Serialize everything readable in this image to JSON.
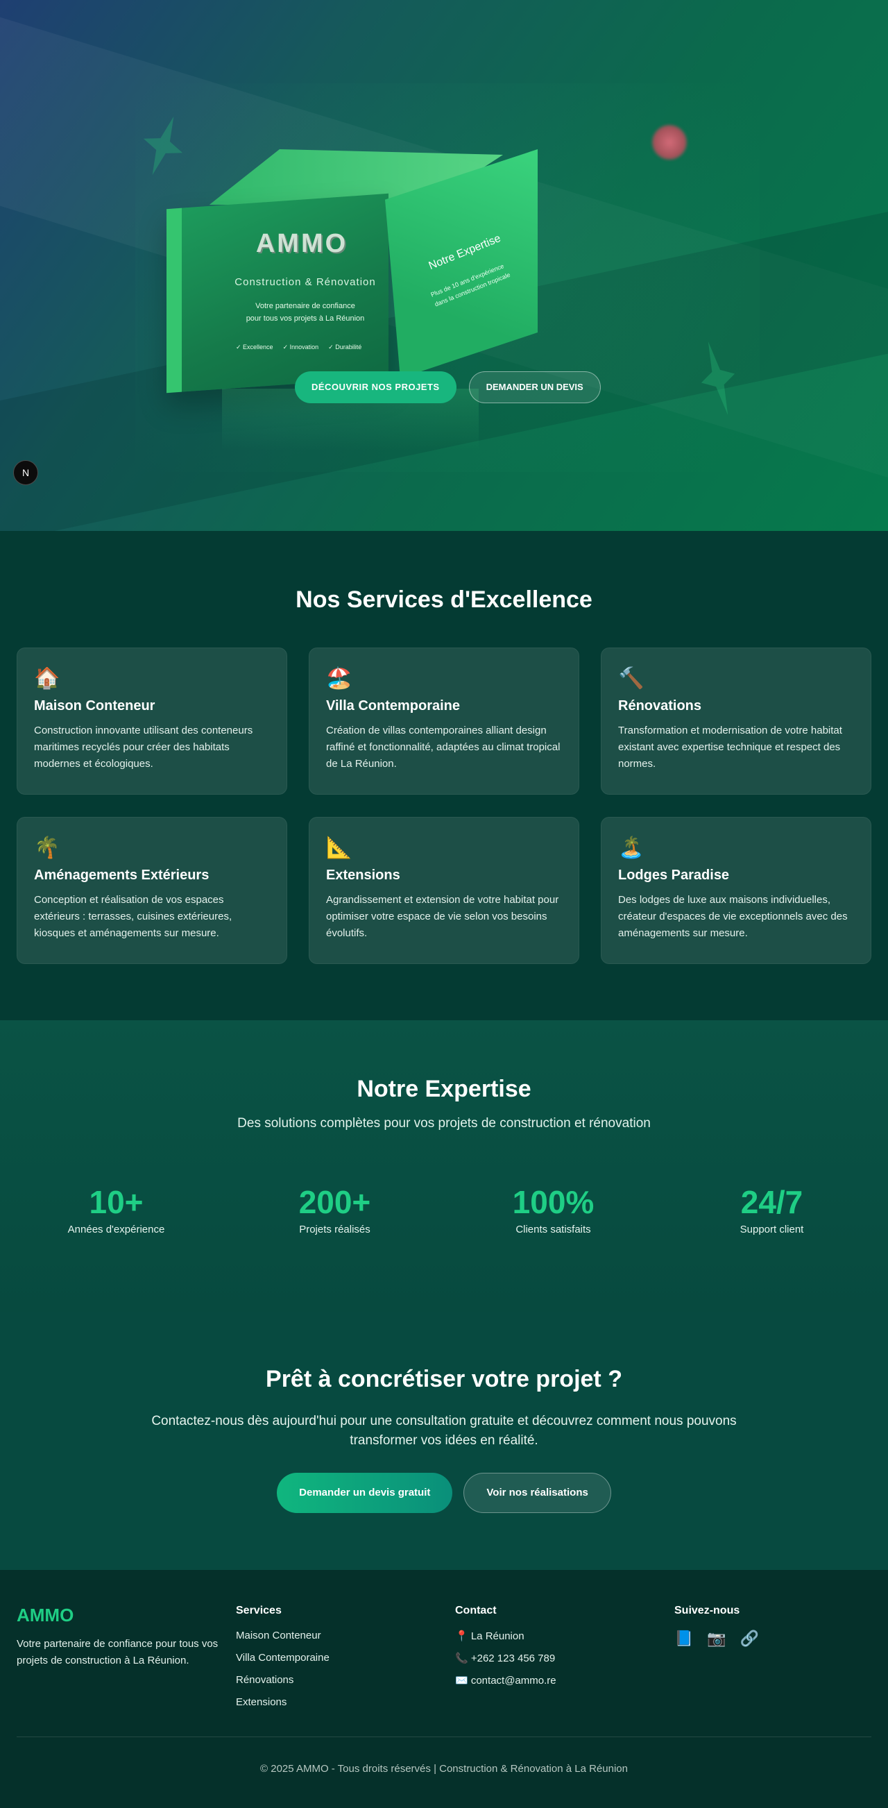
{
  "hero": {
    "brand": "AMMO",
    "brand_subtitle": "Construction & Rénovation",
    "tagline_line1": "Votre partenaire de confiance",
    "tagline_line2": "pour tous vos projets à La Réunion",
    "checks": [
      "✓ Excellence",
      "✓ Innovation",
      "✓ Durabilité"
    ],
    "panel_title": "Notre Expertise",
    "panel_sub_line1": "Plus de 10 ans d'expérience",
    "panel_sub_line2": "dans la construction tropicale",
    "cta_primary": "DÉCOUVRIR NOS PROJETS",
    "cta_secondary": "DEMANDER UN DEVIS",
    "scroll_icon": "N"
  },
  "services": {
    "title": "Nos Services d'Excellence",
    "items": [
      {
        "icon": "🏠",
        "icon_name": "house-icon",
        "title": "Maison Conteneur",
        "text": "Construction innovante utilisant des conteneurs maritimes recyclés pour créer des habitats modernes et écologiques."
      },
      {
        "icon": "🏖️",
        "icon_name": "beach-villa-icon",
        "title": "Villa Contemporaine",
        "text": "Création de villas contemporaines alliant design raffiné et fonctionnalité, adaptées au climat tropical de La Réunion."
      },
      {
        "icon": "🔨",
        "icon_name": "hammer-icon",
        "title": "Rénovations",
        "text": "Transformation et modernisation de votre habitat existant avec expertise technique et respect des normes."
      },
      {
        "icon": "🌴",
        "icon_name": "palm-tree-icon",
        "title": "Aménagements Extérieurs",
        "text": "Conception et réalisation de vos espaces extérieurs : terrasses, cuisines extérieures, kiosques et aménagements sur mesure."
      },
      {
        "icon": "📐",
        "icon_name": "set-square-icon",
        "title": "Extensions",
        "text": "Agrandissement et extension de votre habitat pour optimiser votre espace de vie selon vos besoins évolutifs."
      },
      {
        "icon": "🏝️",
        "icon_name": "island-icon",
        "title": "Lodges Paradise",
        "text": "Des lodges de luxe aux maisons individuelles, créateur d'espaces de vie exceptionnels avec des aménagements sur mesure."
      }
    ]
  },
  "expertise": {
    "title": "Notre Expertise",
    "subtitle": "Des solutions complètes pour vos projets de construction et rénovation",
    "stats": [
      {
        "value": "10+",
        "label": "Années d'expérience"
      },
      {
        "value": "200+",
        "label": "Projets réalisés"
      },
      {
        "value": "100%",
        "label": "Clients satisfaits"
      },
      {
        "value": "24/7",
        "label": "Support client"
      }
    ]
  },
  "cta": {
    "title": "Prêt à concrétiser votre projet ?",
    "description": "Contactez-nous dès aujourd'hui pour une consultation gratuite et découvrez comment nous pouvons transformer vos idées en réalité.",
    "primary": "Demander un devis gratuit",
    "secondary": "Voir nos réalisations"
  },
  "footer": {
    "logo": "AMMO",
    "about": "Votre partenaire de confiance pour tous vos projets de construction à La Réunion.",
    "services_title": "Services",
    "services": [
      "Maison Conteneur",
      "Villa Contemporaine",
      "Rénovations",
      "Extensions"
    ],
    "contact_title": "Contact",
    "contact": [
      "📍 La Réunion",
      "📞 +262 123 456 789",
      "✉️ contact@ammo.re"
    ],
    "social_title": "Suivez-nous",
    "social": [
      {
        "icon": "📘",
        "name": "facebook-icon"
      },
      {
        "icon": "📷",
        "name": "instagram-icon"
      },
      {
        "icon": "🔗",
        "name": "link-icon"
      }
    ],
    "copyright": "© 2025 AMMO - Tous droits réservés | Construction & Rénovation à La Réunion"
  },
  "colors": {
    "accent": "#1fce85",
    "primary_button": "#18b67e",
    "background": "#043b33",
    "card": "#1d4f47"
  }
}
